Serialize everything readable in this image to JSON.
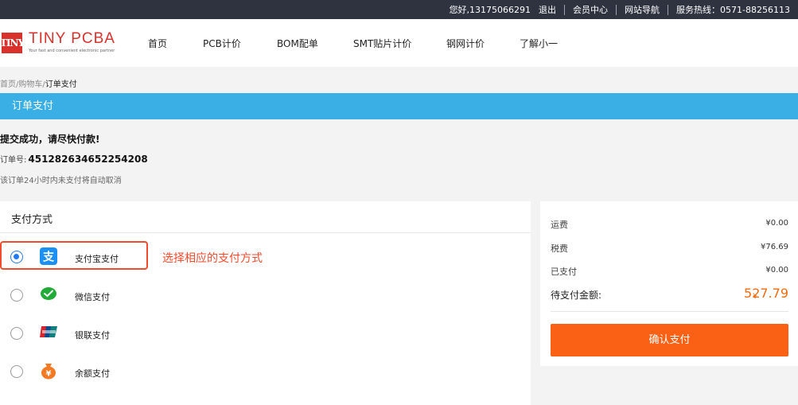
{
  "topbar": {
    "greeting": "您好,13175066291",
    "logout": "退出",
    "member": "会员中心",
    "sitenav": "网站导航",
    "hotline": "服务热线：0571-88256113"
  },
  "logo": {
    "mark": "TINY",
    "name": "TINY PCBA",
    "tagline": "Your fast and convenient electronic partner"
  },
  "nav": {
    "items": [
      "首页",
      "PCB计价",
      "BOM配单",
      "SMT贴片计价",
      "钢网计价",
      "了解小一"
    ]
  },
  "breadcrumb": {
    "home": "首页",
    "cart": "购物车",
    "current": "订单支付",
    "sep": "/"
  },
  "page": {
    "title": "订单支付"
  },
  "message": {
    "title": "提交成功，请尽快付款!",
    "order_label": "订单号:",
    "order_number": "451282634652254208",
    "note": "该订单24小时内未支付将自动取消"
  },
  "payment": {
    "heading": "支付方式",
    "hint": "选择相应的支付方式",
    "selected": "alipay",
    "options": [
      {
        "id": "alipay",
        "label": "支付宝支付",
        "icon": "alipay-icon",
        "color": "#1a8ff4"
      },
      {
        "id": "wechat",
        "label": "微信支付",
        "icon": "wechat-pay-icon",
        "color": "#22ab38"
      },
      {
        "id": "unionpay",
        "label": "银联支付",
        "icon": "unionpay-icon",
        "color": "#d7252d"
      },
      {
        "id": "balance",
        "label": "余额支付",
        "icon": "money-bag-icon",
        "color": "#f37a22"
      }
    ]
  },
  "summary": {
    "shipping_label": "运费",
    "shipping_value": "¥0.00",
    "tax_label": "税费",
    "tax_value": "¥76.69",
    "paid_label": "已支付",
    "paid_value": "¥0.00",
    "due_label": "待支付金额:",
    "due_currency": "¥",
    "due_amount": "527.79",
    "confirm": "确认支付"
  },
  "colors": {
    "topbar": "#2f3340",
    "accent_blue": "#3aafe6",
    "confirm_orange": "#fb6114",
    "brand_red": "#d9322c",
    "annotation_red": "#f04b2d"
  }
}
